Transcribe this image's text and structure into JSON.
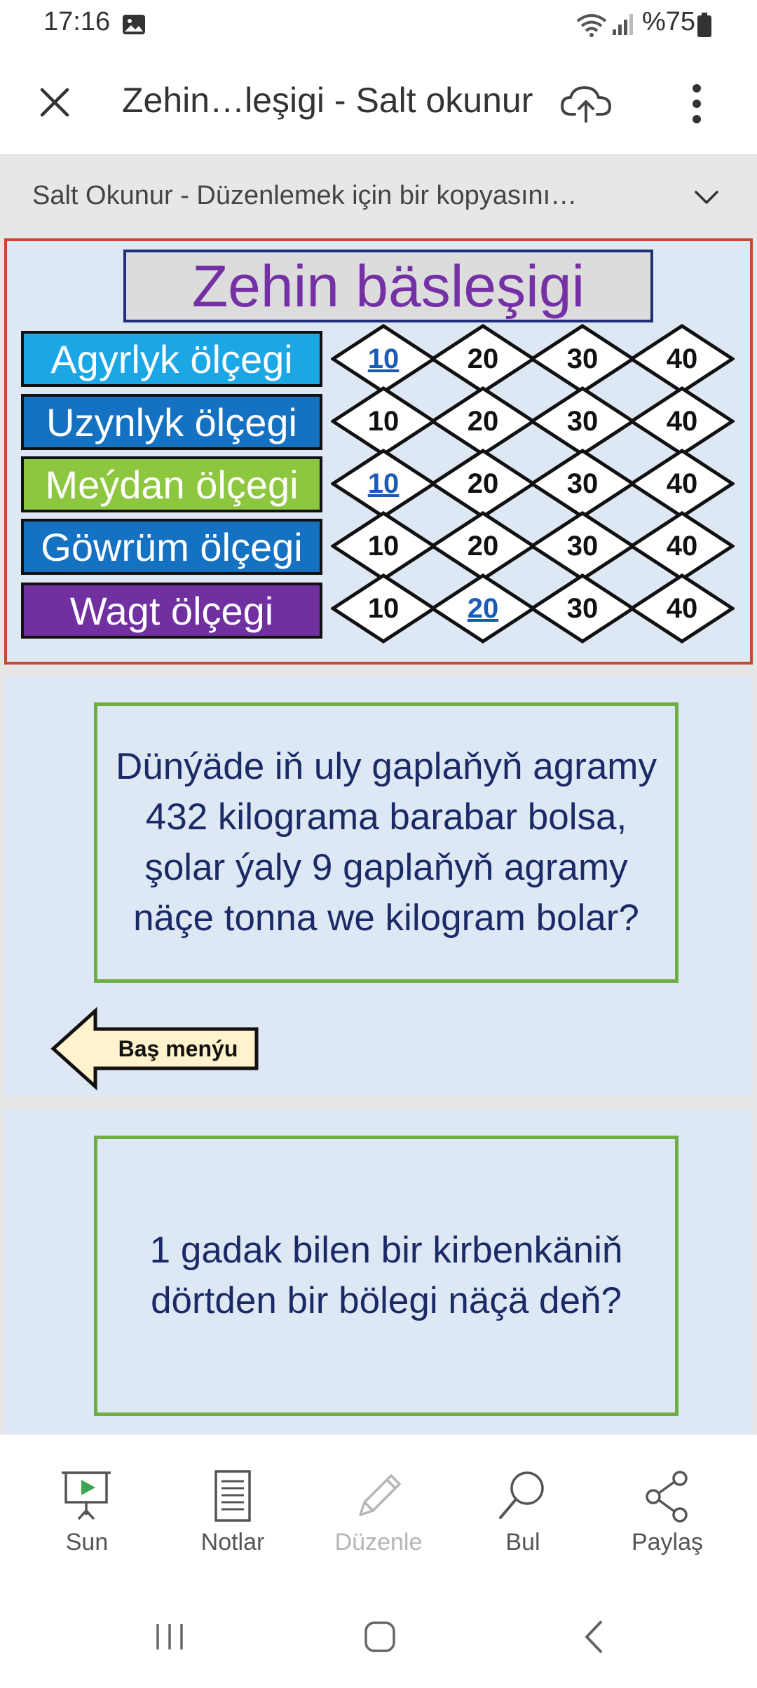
{
  "status_bar": {
    "time": "17:16",
    "battery_text": "%75"
  },
  "app_bar": {
    "title": "Zehin…leşigi - Salt okunur"
  },
  "banner": {
    "text": "Salt Okunur - Düzenlemek için bir kopyasını…"
  },
  "slide1": {
    "title": "Zehin bäsleşigi",
    "categories": [
      {
        "label": "Agyrlyk ölçegi",
        "color": "#1ba7e6"
      },
      {
        "label": "Uzynlyk ölçegi",
        "color": "#1572c2"
      },
      {
        "label": "Meýdan ölçegi",
        "color": "#8dc63f"
      },
      {
        "label": "Göwrüm ölçegi",
        "color": "#1572c2"
      },
      {
        "label": "Wagt ölçegi",
        "color": "#7030a0"
      }
    ],
    "values": [
      "10",
      "20",
      "30",
      "40"
    ]
  },
  "slide2": {
    "question": "Dünýäde iň uly gaplaňyň agramy 432 kilograma barabar bolsa, şolar ýaly 9 gaplaňyň agramy näçe tonna we kilogram bolar?",
    "back_label": "Baş menýu"
  },
  "slide3": {
    "question": "1 gadak bilen bir kirbenkäniň dörtden bir bölegi näçä deň?"
  },
  "toolbar": {
    "present": "Sun",
    "notes": "Notlar",
    "edit": "Düzenle",
    "find": "Bul",
    "share": "Paylaş"
  }
}
